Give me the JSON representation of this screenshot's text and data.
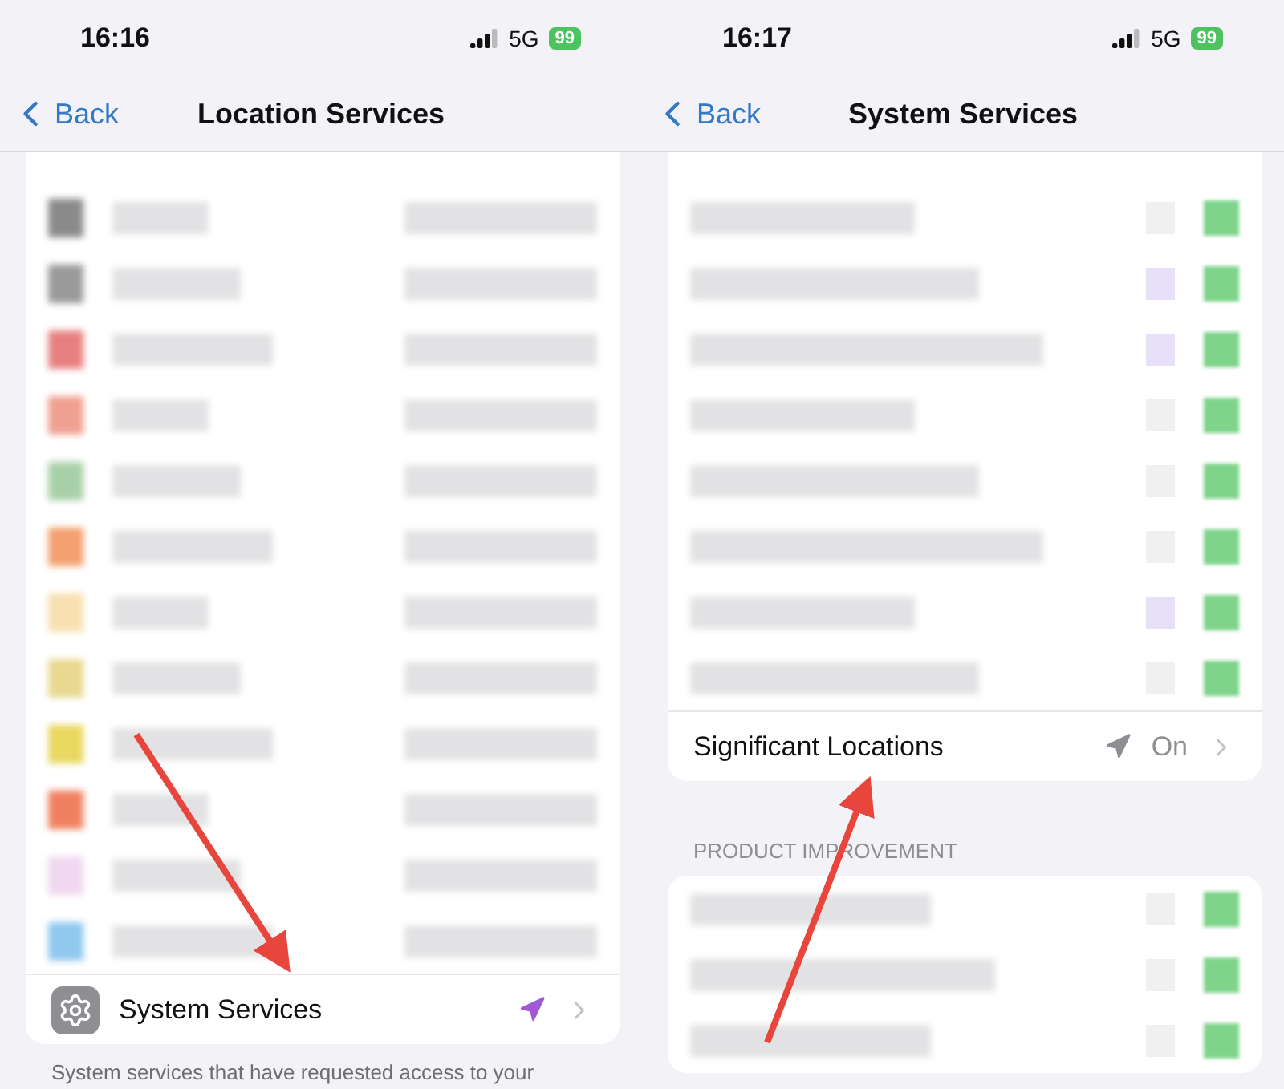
{
  "screens": [
    {
      "status_bar": {
        "time": "16:16",
        "network": "5G",
        "battery": "99"
      },
      "nav": {
        "back": "Back",
        "title": "Location Services"
      },
      "redacted_rows": [
        {
          "color": "#8a8a8a"
        },
        {
          "color": "#9a9a9a"
        },
        {
          "color": "#e88080"
        },
        {
          "color": "#f0a090"
        },
        {
          "color": "#a8d0a8"
        },
        {
          "color": "#f4a070"
        },
        {
          "color": "#f8e0b0"
        },
        {
          "color": "#e8d890"
        },
        {
          "color": "#e8d860"
        },
        {
          "color": "#f08060"
        },
        {
          "color": "#f0d8f0"
        },
        {
          "color": "#90c8f0"
        }
      ],
      "rows": [
        {
          "label": "System Services",
          "recently_used": true,
          "value": ""
        }
      ],
      "footer": "System services that have requested access to your"
    },
    {
      "status_bar": {
        "time": "16:17",
        "network": "5G",
        "battery": "99"
      },
      "nav": {
        "back": "Back",
        "title": "System Services"
      },
      "redacted_rows": [
        {
          "color": "#f0f0f0"
        },
        {
          "color": "#e8e0f8"
        },
        {
          "color": "#e8e0f8"
        },
        {
          "color": "#f0f0f0"
        },
        {
          "color": "#f0f0f0"
        },
        {
          "color": "#f0f0f0"
        },
        {
          "color": "#e8e0f8"
        },
        {
          "color": "#f0f0f0"
        }
      ],
      "rows": [
        {
          "label": "Significant Locations",
          "recently_used": false,
          "value": "On"
        }
      ],
      "section_header": "PRODUCT IMPROVEMENT",
      "second_card_rows": [
        {
          "color": "#f0f0f0"
        },
        {
          "color": "#f0f0f0"
        },
        {
          "color": "#f0f0f0"
        }
      ]
    }
  ]
}
